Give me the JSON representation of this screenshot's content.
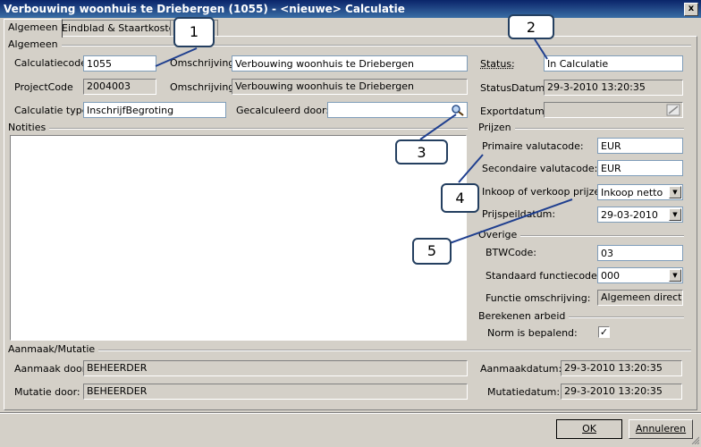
{
  "window": {
    "title": "Verbouwing woonhuis te Driebergen (1055) - <nieuwe> Calculatie",
    "close_label": "x"
  },
  "tabs": [
    {
      "label": "Algemeen"
    },
    {
      "label": "Eindblad & Staartkosten"
    }
  ],
  "algemeen": {
    "group_label": "Algemeen",
    "calculatiecode_label": "Calculatiecode:",
    "calculatiecode_value": "1055",
    "omschrijving1_label": "Omschrijving:",
    "omschrijving1_value": "Verbouwing woonhuis te Driebergen",
    "status_label": "Status:",
    "status_value": "In Calculatie",
    "projectcode_label": "ProjectCode",
    "projectcode_value": "2004003",
    "omschrijving2_label": "Omschrijving:",
    "omschrijving2_value": "Verbouwing woonhuis te Driebergen",
    "statusdatum_label": "StatusDatum:",
    "statusdatum_value": "29-3-2010 13:20:35",
    "calculatietype_label": "Calculatie type:",
    "calculatietype_value": "InschrijfBegroting",
    "gecalculeerd_label": "Gecalculeerd door:",
    "gecalculeerd_value": "",
    "exportdatum_label": "Exportdatum:",
    "exportdatum_value": ""
  },
  "notities": {
    "label": "Notities",
    "value": ""
  },
  "prijzen": {
    "group_label": "Prijzen",
    "primaire_label": "Primaire valutacode:",
    "primaire_value": "EUR",
    "secundaire_label": "Secondaire valutacode:",
    "secundaire_value": "EUR",
    "inkoop_label": "Inkoop of verkoop prijzen:",
    "inkoop_value": "Inkoop netto",
    "prijspeil_label": "Prijspeildatum:",
    "prijspeil_value": "29-03-2010"
  },
  "overige": {
    "group_label": "Overige",
    "btw_label": "BTWCode:",
    "btw_value": "03",
    "functiecode_label": "Standaard functiecode:",
    "functiecode_value": "000",
    "functieomschr_label": "Functie omschrijving:",
    "functieomschr_value": "Algemeen directeu"
  },
  "arbeid": {
    "group_label": "Berekenen arbeid",
    "norm_label": "Norm is bepalend:",
    "norm_checked": true,
    "check_glyph": "✓"
  },
  "mutatie": {
    "group_label": "Aanmaak/Mutatie",
    "aanmaak_door_label": "Aanmaak door:",
    "aanmaak_door_value": "BEHEERDER",
    "aanmaakdatum_label": "Aanmaakdatum:",
    "aanmaakdatum_value": "29-3-2010 13:20:35",
    "mutatie_door_label": "Mutatie door:",
    "mutatie_door_value": "BEHEERDER",
    "mutatiedatum_label": "Mutatiedatum:",
    "mutatiedatum_value": "29-3-2010 13:20:35"
  },
  "buttons": {
    "ok": "OK",
    "annuleren": "Annuleren"
  },
  "callouts": [
    "1",
    "2",
    "3",
    "4",
    "5"
  ],
  "colors": {
    "titlebar": "#0a246a",
    "callout_border": "#243f60",
    "callout_line": "#1f3f8f"
  }
}
